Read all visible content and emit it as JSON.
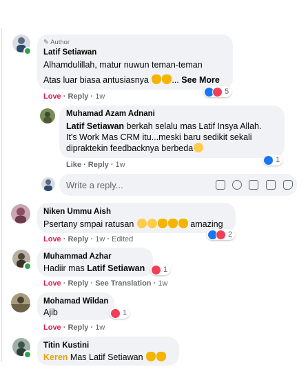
{
  "comments": [
    {
      "author_badge": "Author",
      "name": "Latif Setiawan",
      "line1": "Alhamdulillah, matur nuwun teman-teman",
      "line2": "Atas luar biasa antusiasnya",
      "see_more": "See More",
      "love": "Love",
      "reply": "Reply",
      "time": "1w",
      "reactions": "5"
    },
    {
      "name": "Muhamad Azam Adnani",
      "mention": "Latif Setiawan",
      "line1_rest": " berkah selalu mas Latif Insya Allah.",
      "line2": "It's Work Mas CRM itu...meski baru sedikit sekali",
      "line3": "dipraktekin feedbacknya berbeda",
      "like": "Like",
      "reply": "Reply",
      "time": "1w",
      "reactions": "1"
    },
    {
      "name": "Niken Ummu Aish",
      "text": "Psertany smpai ratusan",
      "text_end": "amazing",
      "love": "Love",
      "reply": "Reply",
      "time": "1w",
      "edited": "Edited",
      "reactions": "2"
    },
    {
      "name": "Muhammad Azhar",
      "text": "Hadiir mas ",
      "mention": "Latif Setiawan",
      "love": "Love",
      "reply": "Reply",
      "translation": "See Translation",
      "time": "1w",
      "reactions": "1"
    },
    {
      "name": "Mohamad Wildan",
      "text": "Ajib",
      "love": "Love",
      "reply": "Reply",
      "time": "1w",
      "reactions": "1"
    },
    {
      "name": "Titin Kustini",
      "keyword": "Keren",
      "text": " Mas Latif Setiawan"
    }
  ],
  "reply_input": {
    "placeholder": "Write a reply..."
  },
  "colors": {
    "love": "#e4134f",
    "bubble": "#f0f2f5",
    "like_blue": "#1877f2",
    "heart_red": "#f33e58",
    "keyword_orange": "#e4a10c"
  },
  "icons": [
    "pencil-icon",
    "emoji-icon",
    "camera-icon",
    "gif-icon",
    "sticker-icon",
    "like-reaction-icon",
    "heart-reaction-icon"
  ]
}
